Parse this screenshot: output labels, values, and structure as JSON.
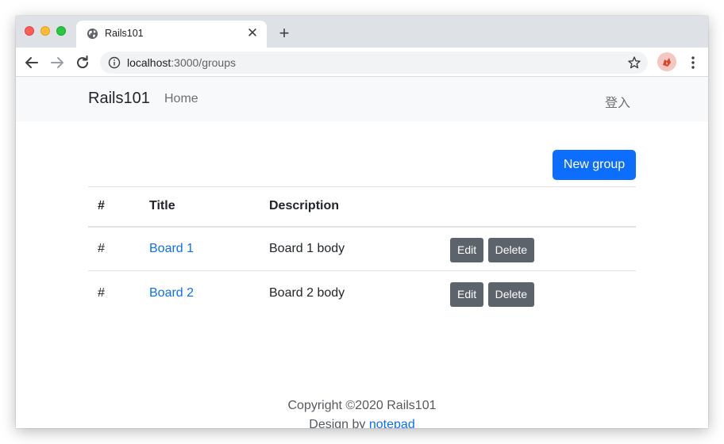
{
  "browser": {
    "tab_title": "Rails101",
    "url_host": "localhost",
    "url_path": ":3000/groups"
  },
  "navbar": {
    "brand": "Rails101",
    "home": "Home",
    "login": "登入"
  },
  "actions": {
    "new_group": "New group"
  },
  "table": {
    "headers": [
      "#",
      "Title",
      "Description"
    ],
    "rows": [
      {
        "num": "#",
        "title": "Board 1",
        "description": "Board 1 body",
        "edit": "Edit",
        "delete": "Delete"
      },
      {
        "num": "#",
        "title": "Board 2",
        "description": "Board 2 body",
        "edit": "Edit",
        "delete": "Delete"
      }
    ]
  },
  "footer": {
    "copyright": "Copyright ©2020 Rails101",
    "design_by": "Design by",
    "designer": "notepad"
  },
  "colors": {
    "primary": "#0d6efd",
    "secondary": "#5c636a",
    "navbar_bg": "#f8f9fa"
  },
  "icons": [
    "globe-icon",
    "close-icon",
    "plus-icon",
    "back-arrow-icon",
    "forward-arrow-icon",
    "reload-icon",
    "info-icon",
    "star-icon",
    "extension-icon",
    "kebab-menu-icon"
  ]
}
